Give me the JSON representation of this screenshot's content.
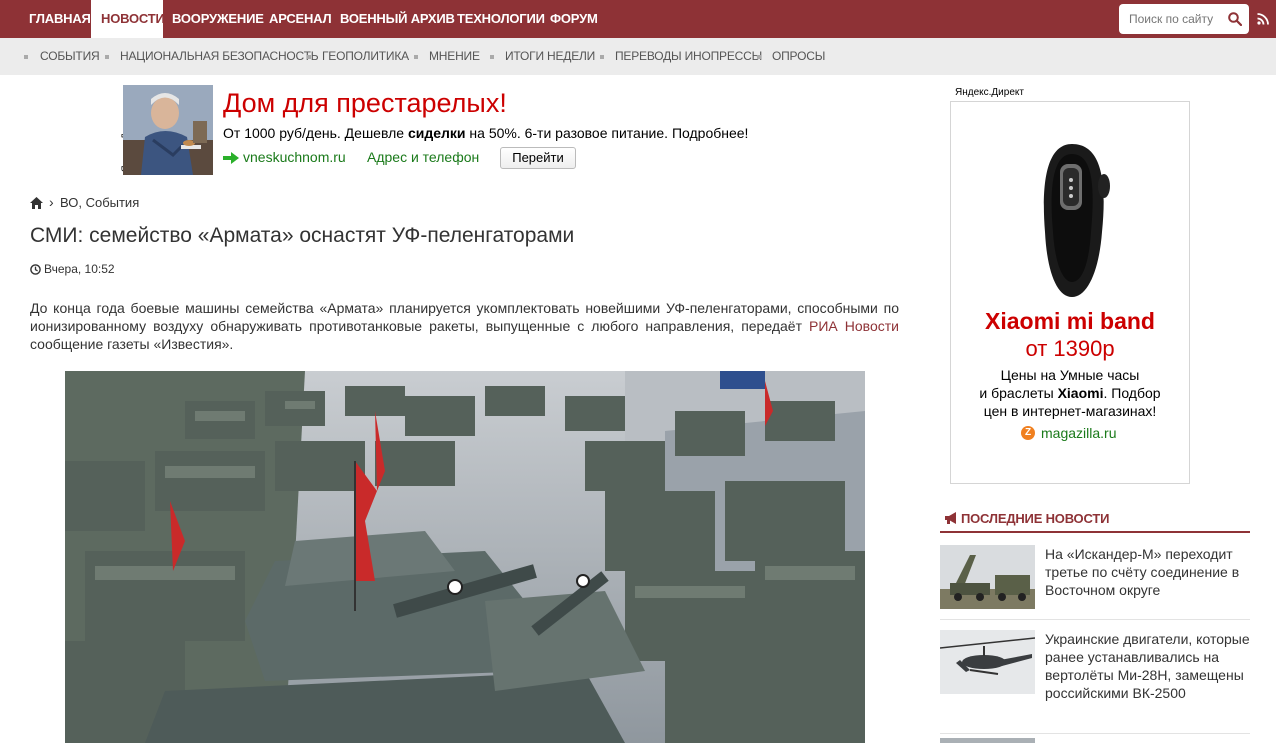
{
  "topnav": {
    "items": [
      "ГЛАВНАЯ",
      "НОВОСТИ",
      "ВООРУЖЕНИЕ",
      "АРСЕНАЛ",
      "ВОЕННЫЙ АРХИВ",
      "ТЕХНОЛОГИИ",
      "ФОРУМ"
    ],
    "active_index": 1,
    "search_placeholder": "Поиск по сайту"
  },
  "subnav": {
    "items": [
      "СОБЫТИЯ",
      "НАЦИОНАЛЬНАЯ БЕЗОПАСНОСТЬ",
      "ГЕОПОЛИТИКА",
      "МНЕНИЕ",
      "ИТОГИ НЕДЕЛИ",
      "ПЕРЕВОДЫ ИНОПРЕССЫ",
      "ОПРОСЫ"
    ]
  },
  "top_ad": {
    "label": "Яндекс.Директ",
    "title": "Дом для престарелых!",
    "text_before": "От 1000 руб/день. Дешевле ",
    "text_bold": "сиделки",
    "text_after": " на 50%. 6-ти разовое питание. Подробнее!",
    "domain": "vneskuchnom.ru",
    "address_link": "Адрес и телефон",
    "go_button": "Перейти"
  },
  "breadcrumb": {
    "sep": "›",
    "text": "ВО, События"
  },
  "article": {
    "title": "СМИ: семейство «Армата» оснастят УФ-пеленгаторами",
    "time": "Вчера, 10:52",
    "body_before": "До конца года боевые машины семейства «Армата» планируется укомплектовать новейшими УФ-пеленгаторами, способными по ионизированному воздуху обнаруживать противотанковые ракеты, выпущенные с любого направления, передаёт ",
    "body_link": "РИА Новости",
    "body_after": " сообщение газеты «Известия»."
  },
  "right_ad": {
    "label": "Яндекс.Директ",
    "title": "Xiaomi mi band",
    "price": "от 1390р",
    "desc_line1": "Цены на Умные часы",
    "desc_line2_before": "и браслеты ",
    "desc_line2_bold": "Xiaomi",
    "desc_line2_after": ". Подбор",
    "desc_line3": "цен в интернет-магазинах!",
    "icon_letter": "Z",
    "domain": "magazilla.ru"
  },
  "latest_news": {
    "heading": "ПОСЛЕДНИЕ НОВОСТИ",
    "items": [
      {
        "text": "На «Искандер-М» переходит третье по счёту соединение в Восточном округе"
      },
      {
        "text": "Украинские двигатели, которые ранее устанавливались на вертолёты Ми-28Н, замещены российскими ВК-2500"
      }
    ]
  },
  "colors": {
    "brand": "#8e3236",
    "ad_red": "#cc0000",
    "ad_green": "#1a7a1a",
    "subnav_bg": "#ececec"
  }
}
